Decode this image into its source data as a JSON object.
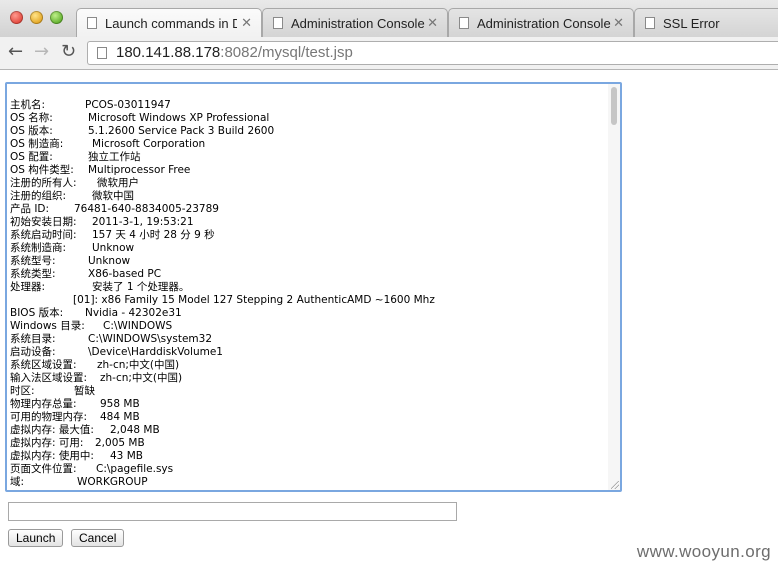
{
  "browser": {
    "tabs": [
      {
        "title": "Launch commands in D:\\"
      },
      {
        "title": "Administration Console"
      },
      {
        "title": "Administration Console"
      },
      {
        "title": "SSL Error"
      }
    ],
    "url_host": "180.141.88.178",
    "url_rest": ":8082/mysql/test.jsp"
  },
  "console": {
    "lines": [
      {
        "k": "主机名:",
        "v": "PCOS-03011947"
      },
      {
        "k": "OS 名称:",
        "v": "Microsoft Windows XP Professional"
      },
      {
        "k": "OS 版本:",
        "v": "5.1.2600 Service Pack 3 Build 2600"
      },
      {
        "k": "OS 制造商:",
        "v": "Microsoft Corporation"
      },
      {
        "k": "OS 配置:",
        "v": "独立工作站"
      },
      {
        "k": "OS 构件类型:",
        "v": "Multiprocessor Free"
      },
      {
        "k": "注册的所有人:",
        "v": "微软用户"
      },
      {
        "k": "注册的组织:",
        "v": "微软中国"
      },
      {
        "k": "产品 ID:",
        "v": "76481-640-8834005-23789"
      },
      {
        "k": "初始安装日期:",
        "v": "2011-3-1, 19:53:21"
      },
      {
        "k": "系统启动时间:",
        "v": "157 天 4 小时 28 分 9 秒"
      },
      {
        "k": "系统制造商:",
        "v": "Unknow"
      },
      {
        "k": "系统型号:",
        "v": "Unknow"
      },
      {
        "k": "系统类型:",
        "v": "X86-based PC"
      },
      {
        "k": "处理器:",
        "v": "安装了 1 个处理器。"
      },
      {
        "k": "",
        "v": "[01]: x86 Family 15 Model 127 Stepping 2 AuthenticAMD ~1600 Mhz"
      },
      {
        "k": "BIOS 版本:",
        "v": "Nvidia - 42302e31"
      },
      {
        "k": "Windows 目录:",
        "v": "C:\\WINDOWS"
      },
      {
        "k": "系统目录:",
        "v": "C:\\WINDOWS\\system32"
      },
      {
        "k": "启动设备:",
        "v": "\\Device\\HarddiskVolume1"
      },
      {
        "k": "系统区域设置:",
        "v": "zh-cn;中文(中国)"
      },
      {
        "k": "输入法区域设置:",
        "v": "zh-cn;中文(中国)"
      },
      {
        "k": "时区:",
        "v": "暂缺"
      },
      {
        "k": "物理内存总量:",
        "v": "958 MB"
      },
      {
        "k": "可用的物理内存:",
        "v": "484 MB"
      },
      {
        "k": "虚拟内存: 最大值:",
        "v": "2,048 MB"
      },
      {
        "k": "虚拟内存: 可用:",
        "v": "2,005 MB"
      },
      {
        "k": "虚拟内存: 使用中:",
        "v": "43 MB"
      },
      {
        "k": "页面文件位置:",
        "v": "C:\\pagefile.sys"
      },
      {
        "k": "域:",
        "v": "WORKGROUP"
      }
    ]
  },
  "form": {
    "command_value": "",
    "launch_label": "Launch",
    "cancel_label": "Cancel"
  },
  "watermark": "www.wooyun.org",
  "colors": {
    "focus_ring": "#7aa7e0"
  }
}
